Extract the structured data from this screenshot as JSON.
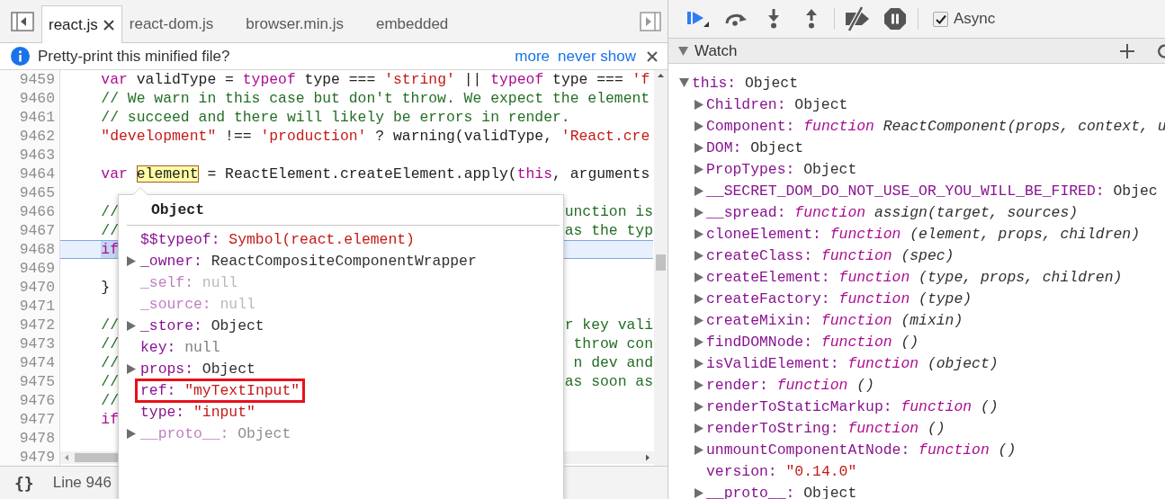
{
  "editor_tabs": [
    {
      "label": "react.js",
      "selected": true
    },
    {
      "label": "react-dom.js",
      "selected": false
    },
    {
      "label": "browser.min.js",
      "selected": false
    },
    {
      "label": "embedded",
      "selected": false
    }
  ],
  "info_bar": {
    "message": "Pretty-print this minified file?",
    "links": [
      "more",
      "never show"
    ]
  },
  "code_lines": [
    {
      "number": "9459",
      "current": false,
      "tokens": [
        {
          "kind": "keyword",
          "text": "var"
        },
        {
          "kind": "plain",
          "text": " validType = "
        },
        {
          "kind": "keyword",
          "text": "typeof"
        },
        {
          "kind": "plain",
          "text": " type === "
        },
        {
          "kind": "string",
          "text": "'string'"
        },
        {
          "kind": "plain",
          "text": " || "
        },
        {
          "kind": "keyword",
          "text": "typeof"
        },
        {
          "kind": "plain",
          "text": " type === "
        },
        {
          "kind": "string",
          "text": "'f"
        }
      ]
    },
    {
      "number": "9460",
      "current": false,
      "tokens": [
        {
          "kind": "comment",
          "text": "// We warn in this case but don't throw. We expect the element"
        }
      ]
    },
    {
      "number": "9461",
      "current": false,
      "tokens": [
        {
          "kind": "comment",
          "text": "// succeed and there will likely be errors in render."
        }
      ]
    },
    {
      "number": "9462",
      "current": false,
      "tokens": [
        {
          "kind": "string",
          "text": "\"development\""
        },
        {
          "kind": "plain",
          "text": " !== "
        },
        {
          "kind": "string",
          "text": "'production'"
        },
        {
          "kind": "plain",
          "text": " ? warning(validType, "
        },
        {
          "kind": "string",
          "text": "'React.cre"
        }
      ]
    },
    {
      "number": "9463",
      "current": false
    },
    {
      "number": "9464",
      "current": false,
      "tokens": [
        {
          "kind": "keyword",
          "text": "var "
        },
        {
          "kind": "match",
          "text": "element"
        },
        {
          "kind": "plain",
          "text": " = ReactElement.createElement.apply("
        },
        {
          "kind": "keyword",
          "text": "this"
        },
        {
          "kind": "plain",
          "text": ", arguments"
        }
      ]
    },
    {
      "number": "9465",
      "current": false
    },
    {
      "number": "9466",
      "current": false,
      "tokens": [
        {
          "kind": "comment",
          "text": "//"
        }
      ],
      "tail": [
        {
          "kind": "comment",
          "text": "unction is"
        }
      ]
    },
    {
      "number": "9467",
      "current": false,
      "tokens": [
        {
          "kind": "comment",
          "text": "//"
        }
      ],
      "tail": [
        {
          "kind": "comment",
          "text": "as the typ"
        }
      ]
    },
    {
      "number": "9468",
      "current": true,
      "tokens": [
        {
          "kind": "selection",
          "text": "if"
        }
      ]
    },
    {
      "number": "9469",
      "current": false
    },
    {
      "number": "9470",
      "current": false,
      "tokens": [
        {
          "kind": "plain",
          "text": "}"
        }
      ]
    },
    {
      "number": "9471",
      "current": false
    },
    {
      "number": "9472",
      "current": false,
      "tokens": [
        {
          "kind": "comment",
          "text": "//"
        }
      ],
      "tail": [
        {
          "kind": "comment",
          "text": "r key vali"
        }
      ]
    },
    {
      "number": "9473",
      "current": false,
      "tokens": [
        {
          "kind": "comment",
          "text": "//"
        }
      ],
      "tail": [
        {
          "kind": "comment",
          "text": "throw con"
        }
      ]
    },
    {
      "number": "9474",
      "current": false,
      "tokens": [
        {
          "kind": "comment",
          "text": "//"
        }
      ],
      "tail": [
        {
          "kind": "comment",
          "text": "n dev and"
        }
      ]
    },
    {
      "number": "9475",
      "current": false,
      "tokens": [
        {
          "kind": "comment",
          "text": "//"
        }
      ],
      "tail": [
        {
          "kind": "comment",
          "text": "as soon as"
        }
      ]
    },
    {
      "number": "9476",
      "current": false,
      "tokens": [
        {
          "kind": "comment",
          "text": "//"
        }
      ]
    },
    {
      "number": "9477",
      "current": false,
      "tokens": [
        {
          "kind": "keyword",
          "text": "if"
        }
      ]
    },
    {
      "number": "9478",
      "current": false
    },
    {
      "number": "9479",
      "current": false
    }
  ],
  "status_bar": {
    "pretty_print_button": "{}",
    "position": "Line 946"
  },
  "popover": {
    "title": "Object",
    "properties": [
      {
        "key": "$$typeof:",
        "value": "Symbol(react.element)",
        "kind": "string",
        "expandable": false,
        "dimmed": false,
        "outlined": false
      },
      {
        "key": "_owner:",
        "value": "ReactCompositeComponentWrapper",
        "kind": "object",
        "expandable": true,
        "dimmed": false,
        "outlined": false
      },
      {
        "key": "_self:",
        "value": "null",
        "kind": "null",
        "expandable": false,
        "dimmed": true,
        "outlined": false
      },
      {
        "key": "_source:",
        "value": "null",
        "kind": "null",
        "expandable": false,
        "dimmed": true,
        "outlined": false
      },
      {
        "key": "_store:",
        "value": "Object",
        "kind": "object",
        "expandable": true,
        "dimmed": false,
        "outlined": false
      },
      {
        "key": "key:",
        "value": "null",
        "kind": "null",
        "expandable": false,
        "dimmed": false,
        "outlined": false
      },
      {
        "key": "props:",
        "value": "Object",
        "kind": "object",
        "expandable": true,
        "dimmed": false,
        "outlined": false
      },
      {
        "key": "ref:",
        "value": "\"myTextInput\"",
        "kind": "string",
        "expandable": false,
        "dimmed": false,
        "outlined": true
      },
      {
        "key": "type:",
        "value": "\"input\"",
        "kind": "string",
        "expandable": false,
        "dimmed": false,
        "outlined": false
      },
      {
        "key": "__proto__:",
        "value": "Object",
        "kind": "object",
        "expandable": true,
        "dimmed": true,
        "outlined": false
      }
    ]
  },
  "debugger_toolbar": {
    "async": {
      "label": "Async",
      "checked": true
    }
  },
  "watch": {
    "title": "Watch",
    "expanded": true,
    "items": [
      {
        "key": "this:",
        "value": "Object",
        "kind": "object",
        "expandable": true,
        "expanded": true,
        "children": [
          {
            "key": "Children:",
            "value": "Object",
            "kind": "object",
            "expandable": true,
            "expanded": false
          },
          {
            "key": "Component:",
            "value": "function",
            "signature": "ReactComponent(props, context, u",
            "kind": "function",
            "expandable": true,
            "expanded": false
          },
          {
            "key": "DOM:",
            "value": "Object",
            "kind": "object",
            "expandable": true,
            "expanded": false
          },
          {
            "key": "PropTypes:",
            "value": "Object",
            "kind": "object",
            "expandable": true,
            "expanded": false
          },
          {
            "key": "__SECRET_DOM_DO_NOT_USE_OR_YOU_WILL_BE_FIRED:",
            "value": "Objec",
            "kind": "object",
            "expandable": true,
            "expanded": false
          },
          {
            "key": "__spread:",
            "value": "function",
            "signature": "assign(target, sources)",
            "kind": "function",
            "expandable": true,
            "expanded": false
          },
          {
            "key": "cloneElement:",
            "value": "function",
            "signature": "(element, props, children)",
            "kind": "function",
            "expandable": true,
            "expanded": false
          },
          {
            "key": "createClass:",
            "value": "function",
            "signature": "(spec)",
            "kind": "function",
            "expandable": true,
            "expanded": false
          },
          {
            "key": "createElement:",
            "value": "function",
            "signature": "(type, props, children)",
            "kind": "function",
            "expandable": true,
            "expanded": false
          },
          {
            "key": "createFactory:",
            "value": "function",
            "signature": "(type)",
            "kind": "function",
            "expandable": true,
            "expanded": false
          },
          {
            "key": "createMixin:",
            "value": "function",
            "signature": "(mixin)",
            "kind": "function",
            "expandable": true,
            "expanded": false
          },
          {
            "key": "findDOMNode:",
            "value": "function",
            "signature": "()",
            "kind": "function",
            "expandable": true,
            "expanded": false
          },
          {
            "key": "isValidElement:",
            "value": "function",
            "signature": "(object)",
            "kind": "function",
            "expandable": true,
            "expanded": false
          },
          {
            "key": "render:",
            "value": "function",
            "signature": "()",
            "kind": "function",
            "expandable": true,
            "expanded": false
          },
          {
            "key": "renderToStaticMarkup:",
            "value": "function",
            "signature": "()",
            "kind": "function",
            "expandable": true,
            "expanded": false
          },
          {
            "key": "renderToString:",
            "value": "function",
            "signature": "()",
            "kind": "function",
            "expandable": true,
            "expanded": false
          },
          {
            "key": "unmountComponentAtNode:",
            "value": "function",
            "signature": "()",
            "kind": "function",
            "expandable": true,
            "expanded": false
          },
          {
            "key": "version:",
            "value": "\"0.14.0\"",
            "kind": "string",
            "expandable": false
          },
          {
            "key": "__proto__:",
            "value": "Object",
            "kind": "object",
            "expandable": true,
            "expanded": false
          }
        ]
      }
    ]
  }
}
